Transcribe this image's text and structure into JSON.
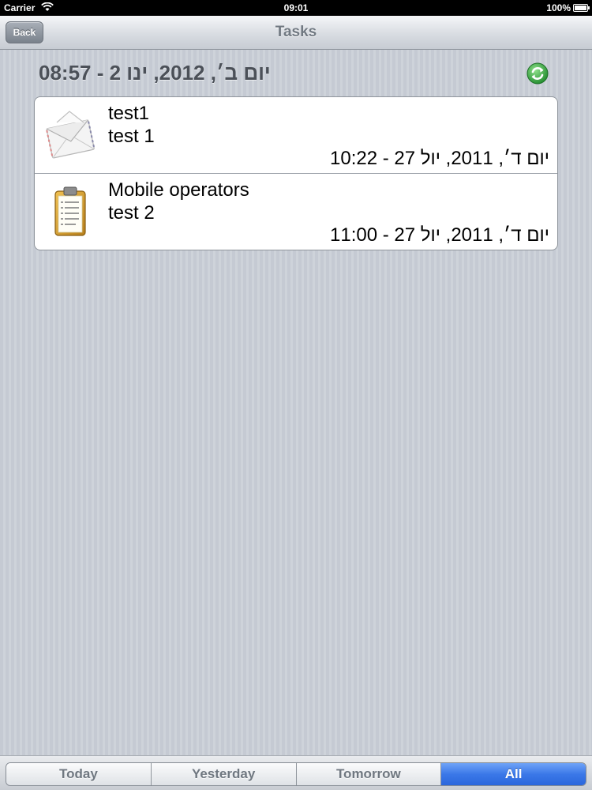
{
  "status_bar": {
    "carrier": "Carrier",
    "time": "09:01",
    "battery": "100%"
  },
  "nav": {
    "back_label": "Back",
    "title": "Tasks"
  },
  "date_header": "יום ב׳, 2012, ינו 2 - 08:57",
  "tasks": [
    {
      "icon": "envelope-icon",
      "title": "test1",
      "subtitle": "test 1",
      "date": "יום ד׳, 2011, יול 27 - 10:22"
    },
    {
      "icon": "clipboard-icon",
      "title": "Mobile operators",
      "subtitle": "test 2",
      "date": "יום ד׳, 2011, יול 27 - 11:00"
    }
  ],
  "filter_tabs": [
    "Today",
    "Yesterday",
    "Tomorrow",
    "All"
  ],
  "selected_tab": "All",
  "colors": {
    "accent": "#3b78e8",
    "background": "#c9ced6",
    "refresh": "#3aa845"
  }
}
